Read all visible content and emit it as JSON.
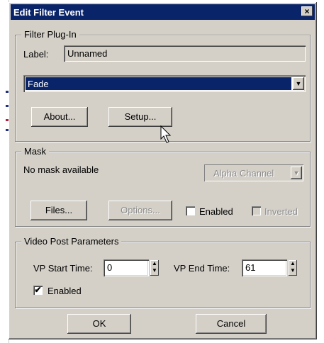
{
  "window": {
    "title": "Edit Filter Event",
    "close_glyph": "×"
  },
  "filter_plugin": {
    "group_label": "Filter Plug-In",
    "label_caption": "Label:",
    "label_value": "Unnamed",
    "selected_filter": "Fade",
    "about_label": "About...",
    "setup_label": "Setup..."
  },
  "mask": {
    "group_label": "Mask",
    "status_text": "No mask available",
    "channel_value": "Alpha Channel",
    "files_label": "Files...",
    "options_label": "Options...",
    "enabled_label": "Enabled",
    "enabled_checked": false,
    "inverted_label": "Inverted",
    "inverted_checked": false
  },
  "video_post": {
    "group_label": "Video Post Parameters",
    "start_label": "VP Start Time:",
    "start_value": "0",
    "end_label": "VP End Time:",
    "end_value": "61",
    "enabled_label": "Enabled",
    "enabled_checked": true,
    "check_glyph": "✔"
  },
  "footer": {
    "ok_label": "OK",
    "cancel_label": "Cancel"
  },
  "colors": {
    "title_bar": "#0a246a",
    "dialog_face": "#d4d0c8",
    "selection": "#0a246a"
  }
}
